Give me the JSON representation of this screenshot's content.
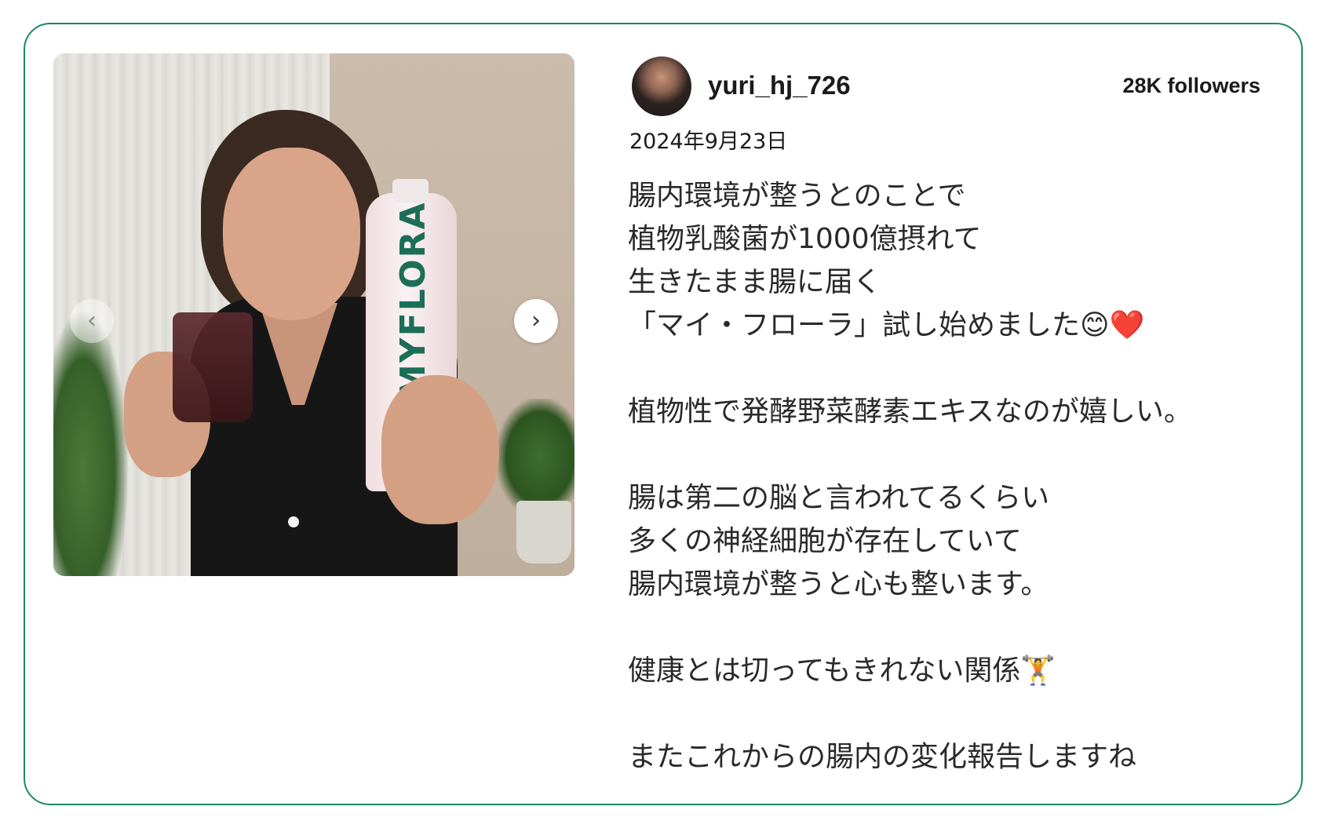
{
  "post": {
    "username": "yuri_hj_726",
    "followers": "28K followers",
    "date": "2024年9月23日",
    "caption_lines": [
      "腸内環境が整うとのことで",
      "植物乳酸菌が1000億摂れて",
      "生きたまま腸に届く",
      "「マイ・フローラ」試し始めました😊❤️",
      "",
      "植物性で発酵野菜酵素エキスなのが嬉しい。",
      "",
      "腸は第二の脳と言われてるくらい",
      "多くの神経細胞が存在していて",
      "腸内環境が整うと心も整います。",
      "",
      "健康とは切ってもきれない関係🏋️",
      "",
      "またこれからの腸内の変化報告しますね"
    ]
  },
  "carousel": {
    "prev_icon": "‹",
    "next_icon": "›",
    "product_label": "MYFLORA"
  },
  "colors": {
    "card_border": "#1d8a5e"
  }
}
